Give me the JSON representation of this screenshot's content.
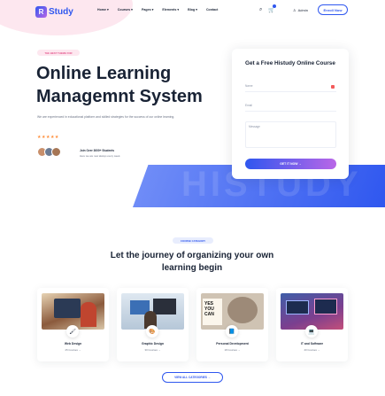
{
  "brand": {
    "logo_mark": "R",
    "name": "Study"
  },
  "nav": [
    "Home ▾",
    "Courses ▾",
    "Pages ▾",
    "Elements ▾",
    "Blog ▾",
    "Contact"
  ],
  "header": {
    "admin_label": "Admin",
    "enroll_label": "Enroll Now"
  },
  "hero": {
    "tag": "THE BEST THEME FOR",
    "title": "Online Learning Managemnt System",
    "subtitle": "We are experienced in educational platform and skilled strategies for the success of our online learning.",
    "stars": "★★★★★",
    "join_title": "Join Over 3000+ Students",
    "join_sub": "Here we are new always every week.",
    "bg_word": "HISTUDY"
  },
  "form": {
    "title": "Get a Free Histudy Online Course",
    "name_placeholder": "Name",
    "email_placeholder": "Email",
    "message_placeholder": "Message",
    "button_label": "GET IT NOW →"
  },
  "categories": {
    "tag": "COURSE CATEGORY",
    "title": "Let the journey of organizing your own learning begin",
    "items": [
      {
        "name": "Web Design",
        "count": "25 Courses →",
        "icon": "🖌"
      },
      {
        "name": "Graphic Design",
        "count": "30 Courses →",
        "icon": "🎨"
      },
      {
        "name": "Personal Development",
        "count": "18 Courses →",
        "icon": "📘"
      },
      {
        "name": "IT and Software",
        "count": "40 Courses →",
        "icon": "💻"
      }
    ],
    "view_all_label": "VIEW ALL CATEGORIES →"
  }
}
